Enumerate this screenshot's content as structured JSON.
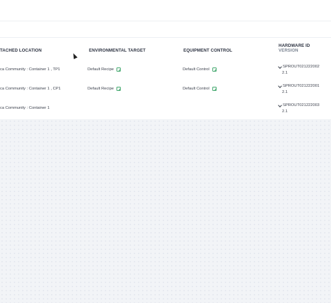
{
  "table": {
    "headers": {
      "location": "TACHED LOCATION",
      "environmental": "ENVIRONMENTAL TARGET",
      "equipment": "EQUIPMENT CONTROL",
      "hardware": "HARDWARE ID",
      "version": "VERSION"
    },
    "rows": [
      {
        "location": "ca Community : Container 1 , TP1",
        "environmental": "Default Recipe",
        "equipment": "Default Control",
        "hardware": "SPROUT021222002",
        "version": "2.1"
      },
      {
        "location": "ca Community : Container 1 , CP1",
        "environmental": "Default Recipe",
        "equipment": "Default Control",
        "hardware": "SPROUT021222001",
        "version": "2.1"
      },
      {
        "location": "ca Community : Container 1",
        "environmental": "",
        "equipment": "",
        "hardware": "SPROUT021222003",
        "version": "2.1"
      }
    ]
  },
  "colors": {
    "edit_icon": "#3fa66b",
    "background": "#f3f5f8"
  },
  "icons": {
    "edit": "edit-icon",
    "expand": "chevron-down-icon",
    "cursor": "cursor-icon"
  }
}
